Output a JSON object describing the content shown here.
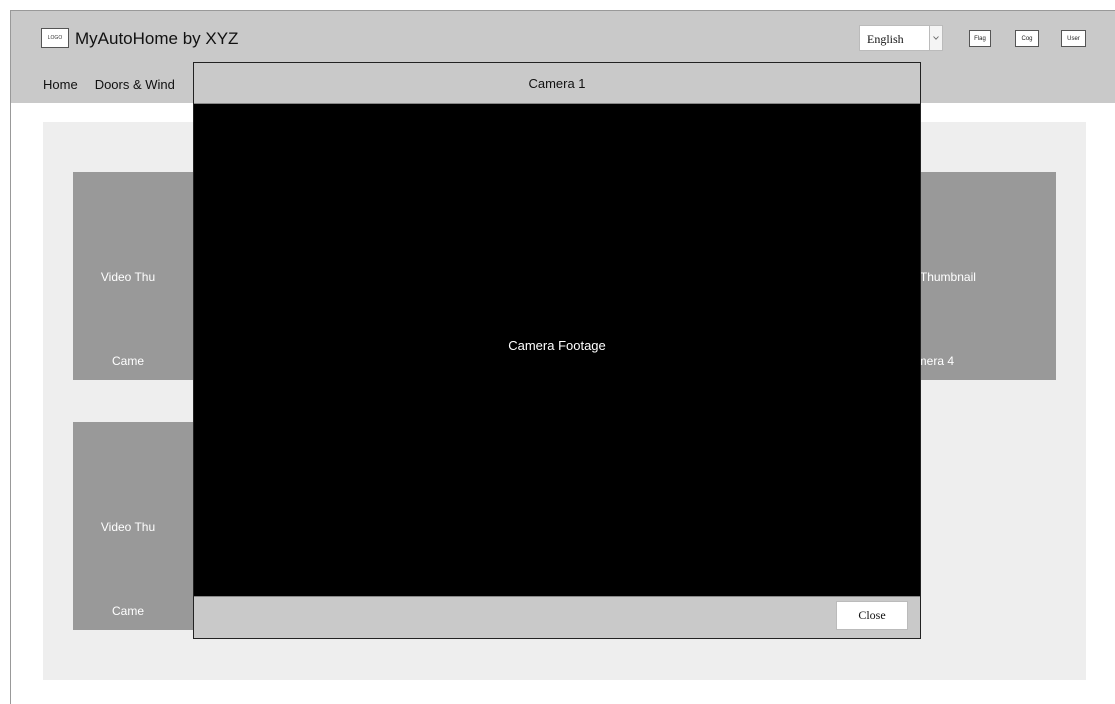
{
  "header": {
    "logo_text": "LOGO",
    "title": "MyAutoHome by XYZ",
    "language": {
      "selected": "English"
    },
    "buttons": {
      "flag": "Flag",
      "cog": "Cog",
      "user": "User"
    }
  },
  "nav": {
    "items": [
      {
        "label": "Home"
      },
      {
        "label": "Doors & Wind"
      }
    ]
  },
  "thumbnails": [
    {
      "label": "Video Thu",
      "camera": "Came"
    },
    {
      "label": "o Thumbnail",
      "camera": "amera 4"
    },
    {
      "label": "Video Thu",
      "camera": "Came"
    }
  ],
  "modal": {
    "title": "Camera 1",
    "body_text": "Camera Footage",
    "close_label": "Close"
  },
  "colors": {
    "header_bg": "#c9c9c9",
    "panel_bg": "#eeeeee",
    "thumb_bg": "#999999",
    "modal_body_bg": "#000000"
  }
}
